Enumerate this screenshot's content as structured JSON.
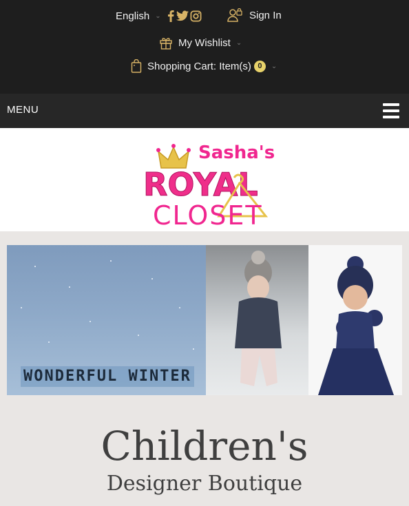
{
  "header": {
    "language": "English",
    "sign_in": "Sign In",
    "wishlist": "My Wishlist",
    "cart_label": "Shopping Cart: Item(s)",
    "cart_count": "0",
    "social_icons": [
      "facebook-icon",
      "twitter-icon",
      "instagram-icon"
    ]
  },
  "nav": {
    "menu_label": "MENU"
  },
  "logo": {
    "line1": "Sasha's",
    "line2": "ROYAL",
    "line3": "CLOSET"
  },
  "hero": {
    "caption": "WONDERFUL WINTER"
  },
  "main": {
    "headline": "Children's",
    "subheadline": "Designer Boutique"
  },
  "colors": {
    "topbar": "#1e1e1e",
    "menubar": "#272727",
    "accent_gold": "#e8d26a",
    "logo_pink": "#f0268f",
    "page_bg": "#e9e6e4"
  }
}
